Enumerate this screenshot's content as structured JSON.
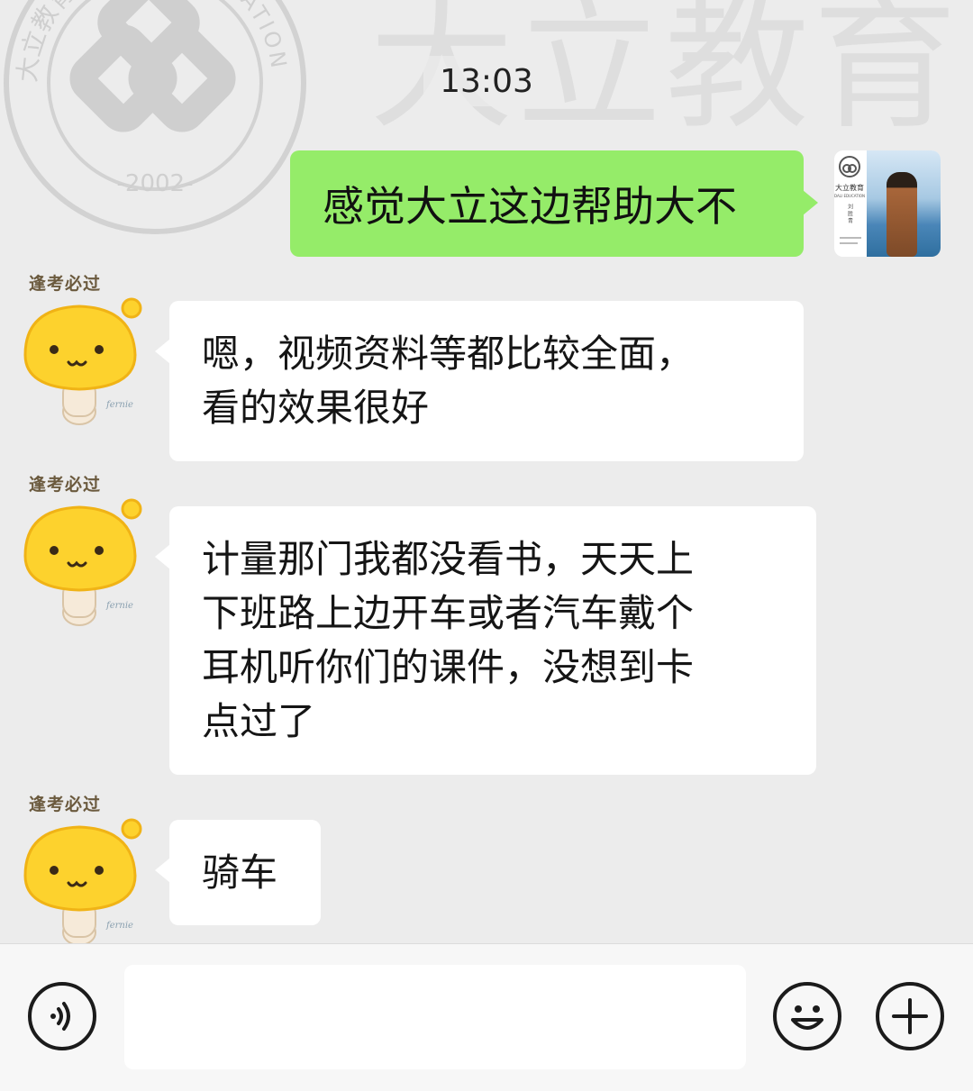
{
  "watermark": {
    "brand_text": "大立教育",
    "seal_top": "大立教育",
    "seal_right": "EDUCATION",
    "seal_year": "-2002-"
  },
  "timestamp": "13:03",
  "self": {
    "message": "感觉大立这边帮助大不",
    "avatar": {
      "logo_text": "大立教育",
      "logo_sub": "DALI EDUCATION",
      "name_vertical": "刘 胜 青"
    }
  },
  "friend": {
    "avatar_slogan": "逢考必过",
    "avatar_signature": "fernie"
  },
  "messages": [
    {
      "from": "friend",
      "lines": [
        "嗯，视频资料等都比较全面，",
        "看的效果很好"
      ]
    },
    {
      "from": "friend",
      "lines": [
        "计量那门我都没看书，天天上",
        "下班路上边开车或者汽车戴个",
        "耳机听你们的课件，没想到卡",
        "点过了"
      ]
    },
    {
      "from": "friend",
      "lines": [
        "骑车"
      ]
    }
  ],
  "input_bar": {
    "voice_icon": "voice-toggle-icon",
    "emoji_icon": "emoji-icon",
    "more_icon": "plus-icon",
    "input_value": ""
  },
  "colors": {
    "background": "#ececec",
    "outgoing_bubble": "#95ec69",
    "incoming_bubble": "#ffffff",
    "input_bar": "#f7f7f7"
  }
}
